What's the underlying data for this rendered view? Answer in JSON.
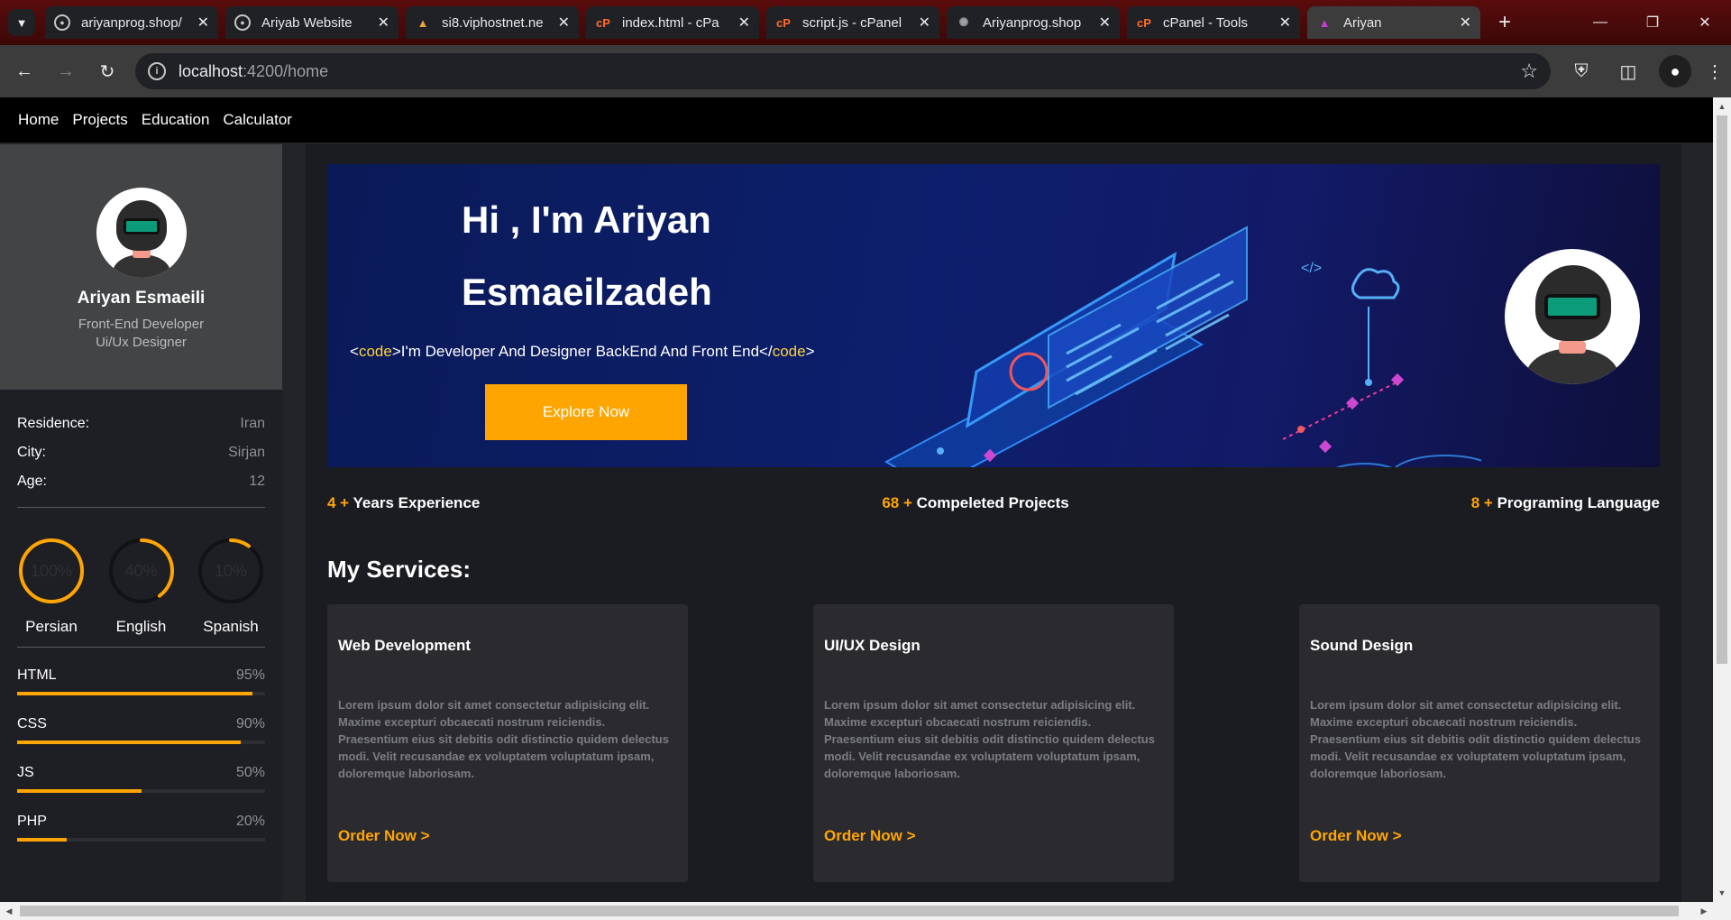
{
  "browser": {
    "tabs": [
      {
        "title": "ariyanprog.shop/",
        "icon": "globe-icon"
      },
      {
        "title": "Ariyab Website",
        "icon": "globe-icon"
      },
      {
        "title": "si8.viphostnet.ne",
        "icon": "site-icon"
      },
      {
        "title": "index.html - cPa",
        "icon": "cpanel-icon"
      },
      {
        "title": "script.js - cPanel",
        "icon": "cpanel-icon"
      },
      {
        "title": "Ariyanprog.shop",
        "icon": "loading-icon"
      },
      {
        "title": "cPanel - Tools",
        "icon": "cpanel-icon"
      },
      {
        "title": "Ariyan",
        "icon": "angular-icon",
        "active": true
      }
    ],
    "url": {
      "host": "localhost",
      "rest": ":4200/home"
    }
  },
  "site_nav": [
    "Home",
    "Projects",
    "Education",
    "Calculator"
  ],
  "profile": {
    "name": "Ariyan Esmaeili",
    "role_line1": "Front-End Developer",
    "role_line2": "Ui/Ux Designer"
  },
  "info": [
    {
      "key": "Residence:",
      "value": "Iran"
    },
    {
      "key": "City:",
      "value": "Sirjan"
    },
    {
      "key": "Age:",
      "value": "12"
    }
  ],
  "languages": [
    {
      "name": "Persian",
      "percent_label": "100%",
      "percent": 100
    },
    {
      "name": "English",
      "percent_label": "40%",
      "percent": 40
    },
    {
      "name": "Spanish",
      "percent_label": "10%",
      "percent": 10
    }
  ],
  "skills": [
    {
      "name": "HTML",
      "percent_label": "95%",
      "percent": 95
    },
    {
      "name": "CSS",
      "percent_label": "90%",
      "percent": 90
    },
    {
      "name": "JS",
      "percent_label": "50%",
      "percent": 50
    },
    {
      "name": "PHP",
      "percent_label": "20%",
      "percent": 20
    }
  ],
  "hero": {
    "line1": "Hi , I'm Ariyan",
    "line2": "Esmaeilzadeh",
    "tag_open": "<",
    "tag_code": "code",
    "tag_mid": ">I'm Developer And Designer BackEnd And Front End</",
    "tag_close": ">",
    "button": "Explore Now"
  },
  "stats": [
    {
      "num": "4 +",
      "label": "Years Experience"
    },
    {
      "num": "68 +",
      "label": "Compeleted Projects"
    },
    {
      "num": "8 +",
      "label": "Programing Language"
    }
  ],
  "services_title": "My Services:",
  "services": [
    {
      "title": "Web Development",
      "desc": "Lorem ipsum dolor sit amet consectetur adipisicing elit. Maxime excepturi obcaecati nostrum reiciendis. Praesentium eius sit debitis odit distinctio quidem delectus modi. Velit recusandae ex voluptatem voluptatum ipsam, doloremque laboriosam.",
      "cta": "Order Now >"
    },
    {
      "title": "UI/UX Design",
      "desc": "Lorem ipsum dolor sit amet consectetur adipisicing elit. Maxime excepturi obcaecati nostrum reiciendis. Praesentium eius sit debitis odit distinctio quidem delectus modi. Velit recusandae ex voluptatem voluptatum ipsam, doloremque laboriosam.",
      "cta": "Order Now >"
    },
    {
      "title": "Sound Design",
      "desc": "Lorem ipsum dolor sit amet consectetur adipisicing elit. Maxime excepturi obcaecati nostrum reiciendis. Praesentium eius sit debitis odit distinctio quidem delectus modi. Velit recusandae ex voluptatem voluptatum ipsam, doloremque laboriosam.",
      "cta": "Order Now >"
    }
  ],
  "colors": {
    "accent": "#ffa502",
    "sidebar": "#1e1f24",
    "card": "#2b2b2f",
    "tabbar": "#3b0808"
  }
}
